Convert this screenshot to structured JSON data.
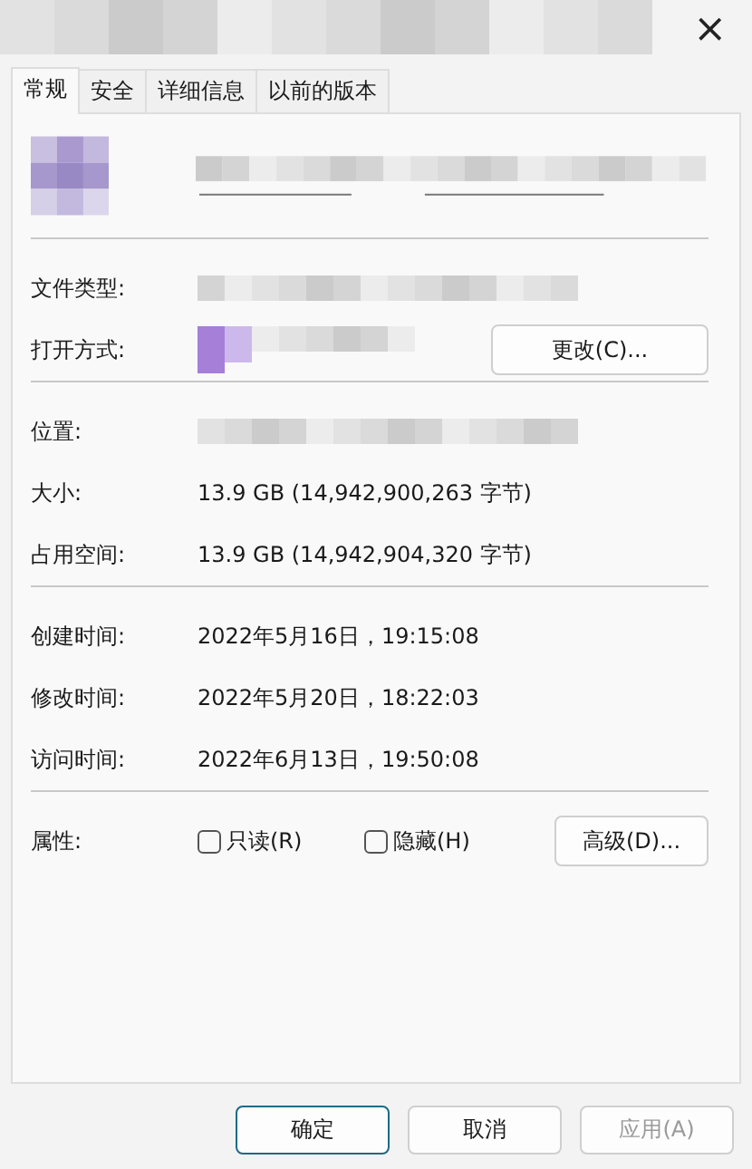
{
  "window": {
    "close": "×"
  },
  "tabs": [
    {
      "label": "常规",
      "selected": true
    },
    {
      "label": "安全",
      "selected": false
    },
    {
      "label": "详细信息",
      "selected": false
    },
    {
      "label": "以前的版本",
      "selected": false
    }
  ],
  "groups": [
    [
      {
        "label": "文件类型:",
        "kind": "blurred"
      },
      {
        "label": "打开方式:",
        "kind": "app",
        "button": "更改(C)..."
      }
    ],
    [
      {
        "label": "位置:",
        "kind": "blurred"
      },
      {
        "label": "大小:",
        "kind": "text",
        "value": "13.9 GB (14,942,900,263 字节)"
      },
      {
        "label": "占用空间:",
        "kind": "text",
        "value": "13.9 GB (14,942,904,320 字节)"
      }
    ],
    [
      {
        "label": "创建时间:",
        "kind": "text",
        "value": "2022年5月16日，19:15:08"
      },
      {
        "label": "修改时间:",
        "kind": "text",
        "value": "2022年5月20日，18:22:03"
      },
      {
        "label": "访问时间:",
        "kind": "text",
        "value": "2022年6月13日，19:50:08"
      }
    ]
  ],
  "attributes": {
    "label": "属性:",
    "options": [
      {
        "label": "只读(R)",
        "checked": false
      },
      {
        "label": "隐藏(H)",
        "checked": false
      }
    ],
    "button": "高级(D)..."
  },
  "buttons": [
    {
      "label": "确定",
      "kind": "default",
      "disabled": false
    },
    {
      "label": "取消",
      "kind": "normal",
      "disabled": false
    },
    {
      "label": "应用(A)",
      "kind": "normal",
      "disabled": true
    }
  ]
}
